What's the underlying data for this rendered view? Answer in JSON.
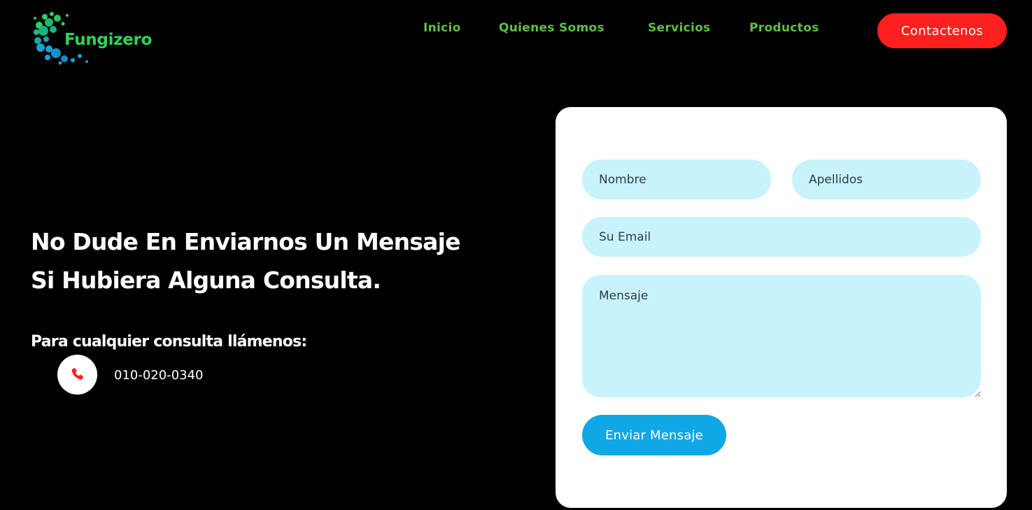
{
  "header": {
    "logo_text": "Fungizero",
    "nav": {
      "inicio": "Inicio",
      "quienes": "Quienes Somos",
      "servicios": "Servicios",
      "productos": "Productos"
    },
    "contact_button": "Contactenos"
  },
  "hero": {
    "heading_line1": "No Dude En Enviarnos Un Mensaje",
    "heading_line2": "Si Hubiera Alguna Consulta.",
    "subheading": "Para cualquier consulta llámenos:",
    "phone_icon": "phone-icon",
    "phone": "010-020-0340"
  },
  "form": {
    "nombre_placeholder": "Nombre",
    "apellidos_placeholder": "Apellidos",
    "email_placeholder": "Su Email",
    "mensaje_placeholder": "Mensaje",
    "submit_label": "Enviar Mensaje"
  },
  "colors": {
    "background": "#000000",
    "nav_text": "#5fbf45",
    "contact_button": "#ff2020",
    "field_bg": "#c8f3fc",
    "submit_button": "#0fa7e6",
    "logo_green": "#2fd35a",
    "logo_blue": "#1b9fd6"
  }
}
